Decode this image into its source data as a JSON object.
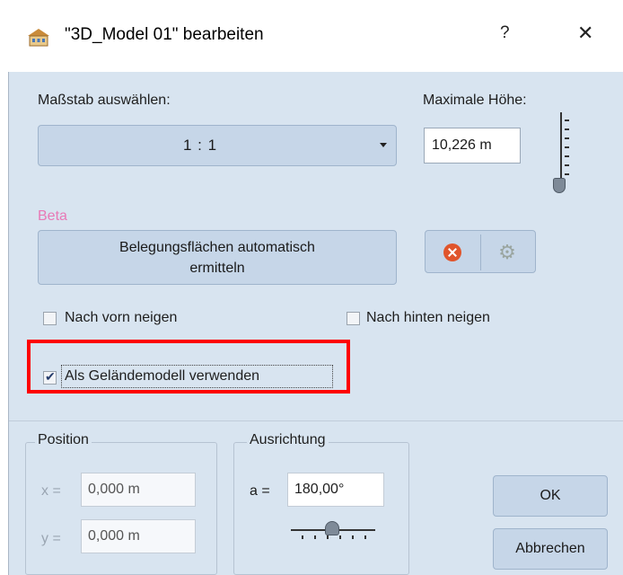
{
  "titlebar": {
    "icon": "house-model-icon",
    "title": "\"3D_Model 01\" bearbeiten",
    "help": "?",
    "close": "✕"
  },
  "scale": {
    "label": "Maßstab auswählen:",
    "value": "1 : 1"
  },
  "max_height": {
    "label": "Maximale Höhe:",
    "value": "10,226 m",
    "slider_level": 0.0
  },
  "beta": {
    "label": "Beta",
    "auto_button": "Belegungsflächen automatisch ermitteln",
    "delete_icon": "delete-icon",
    "settings_icon": "gear-icon"
  },
  "options": {
    "tilt_front": {
      "label": "Nach vorn neigen",
      "checked": false
    },
    "tilt_back": {
      "label": "Nach hinten neigen",
      "checked": false
    },
    "terrain": {
      "label": "Als Geländemodell verwenden",
      "checked": true
    }
  },
  "position": {
    "title": "Position",
    "x_label": "x =",
    "x_value": "0,000 m",
    "y_label": "y =",
    "y_value": "0,000 m"
  },
  "orientation": {
    "title": "Ausrichtung",
    "a_label": "a =",
    "a_value": "180,00°",
    "slider_level": 0.5
  },
  "buttons": {
    "ok": "OK",
    "cancel": "Abbrechen"
  },
  "colors": {
    "highlight": "#ff0000",
    "panel": "#d8e4f0",
    "beta": "#e879b6"
  }
}
